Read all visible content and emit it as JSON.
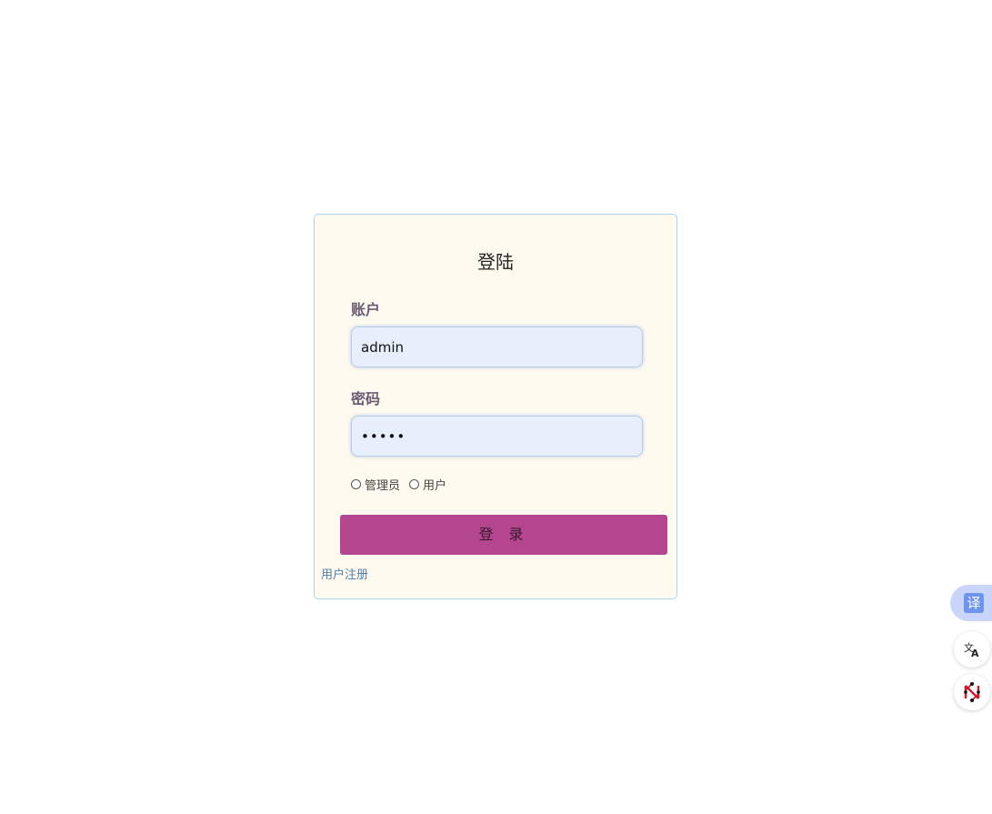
{
  "login": {
    "title": "登陆",
    "account_label": "账户",
    "account_value": "admin",
    "password_label": "密码",
    "password_value": "12345",
    "roles": [
      {
        "label": "管理员",
        "selected": false
      },
      {
        "label": "用户",
        "selected": false
      }
    ],
    "submit_label": "登 录",
    "register_link": "用户注册"
  },
  "side_tools": {
    "translate_glyph": "译",
    "icons": [
      "translate-icon",
      "language-icon",
      "network-icon"
    ]
  },
  "colors": {
    "card_bg": "#fefaf0",
    "card_border": "#a9d3f2",
    "input_bg": "#e7effc",
    "button_bg": "#b3468e",
    "link": "#4f7eb0"
  }
}
